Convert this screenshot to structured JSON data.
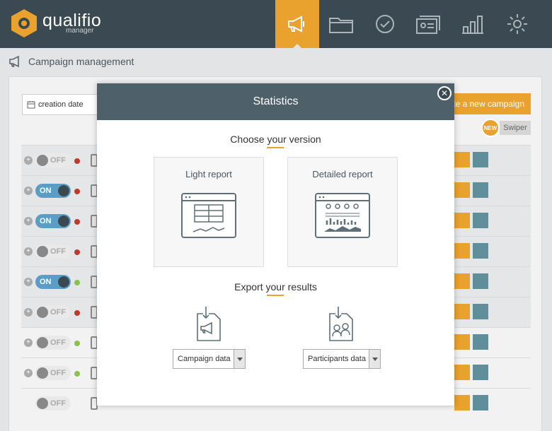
{
  "brand": {
    "name": "qualifio",
    "sub": "manager"
  },
  "nav": [
    "megaphone-icon",
    "folder-icon",
    "check-circle-icon",
    "contacts-icon",
    "bar-chart-icon",
    "gear-icon"
  ],
  "breadcrumb": {
    "label": "Campaign management"
  },
  "filters": {
    "date_value": "creation date"
  },
  "toolbar": {
    "create_label": "te a new campaign",
    "new_badge": "NEW",
    "swiper_label": "Swiper"
  },
  "rows": [
    {
      "state": "OFF",
      "status_color": "#c0392b"
    },
    {
      "state": "ON",
      "status_color": "#c0392b"
    },
    {
      "state": "ON",
      "status_color": "#c0392b"
    },
    {
      "state": "OFF",
      "status_color": "#c0392b"
    },
    {
      "state": "ON",
      "status_color": "#8bc34a"
    },
    {
      "state": "OFF",
      "status_color": "#c0392b"
    },
    {
      "state": "OFF",
      "status_color": "#8bc34a"
    },
    {
      "state": "OFF",
      "status_color": "#8bc34a"
    },
    {
      "state": "OFF",
      "status_color": ""
    }
  ],
  "modal": {
    "title": "Statistics",
    "choose_title": "Choose your version",
    "light_label": "Light report",
    "detailed_label": "Detailed report",
    "export_title": "Export your results",
    "campaign_select": "Campaign data",
    "participants_select": "Participants data"
  },
  "colors": {
    "accent": "#e8a22d",
    "header": "#3b4a52",
    "modal_head": "#4e6069",
    "toggle_on": "#5a9ec8"
  }
}
